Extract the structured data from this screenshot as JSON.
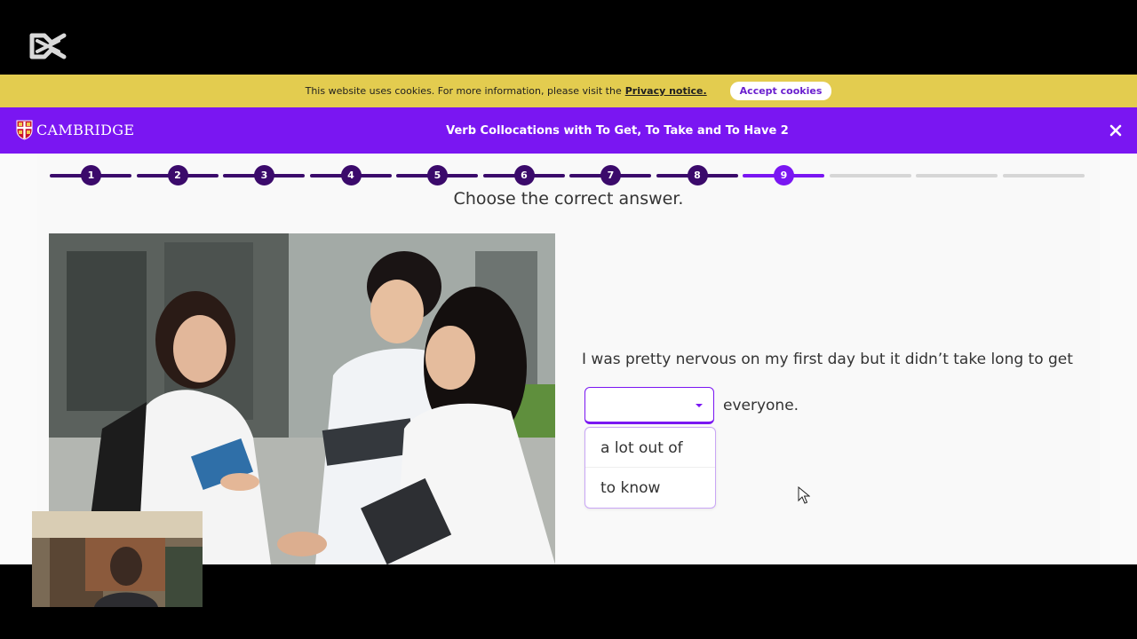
{
  "cookie_bar": {
    "text": "This website uses cookies. For more information, please visit the",
    "link": "Privacy notice.",
    "accept_button": "Accept cookies"
  },
  "header": {
    "brand": "CAMBRIDGE",
    "title": "Verb Collocations with To Get, To Take and To Have 2"
  },
  "progress": {
    "steps": [
      "1",
      "2",
      "3",
      "4",
      "5",
      "6",
      "7",
      "8",
      "9"
    ],
    "total_segments": 12,
    "current_step": 9
  },
  "question": {
    "instruction": "Choose the correct answer.",
    "sentence_before": "I was pretty nervous on my first day but it didn’t take long to get",
    "sentence_after": "everyone.",
    "options": [
      "a lot out of",
      "to know"
    ]
  },
  "colors": {
    "header_purple": "#7a16f2",
    "step_dark": "#3b0a6b",
    "cookie_yellow": "#e3cc4f"
  },
  "icons": {
    "recording_logo": "capcut-logo-icon",
    "close": "close-icon",
    "dropdown": "caret-down-icon",
    "cursor": "mouse-pointer-icon"
  }
}
